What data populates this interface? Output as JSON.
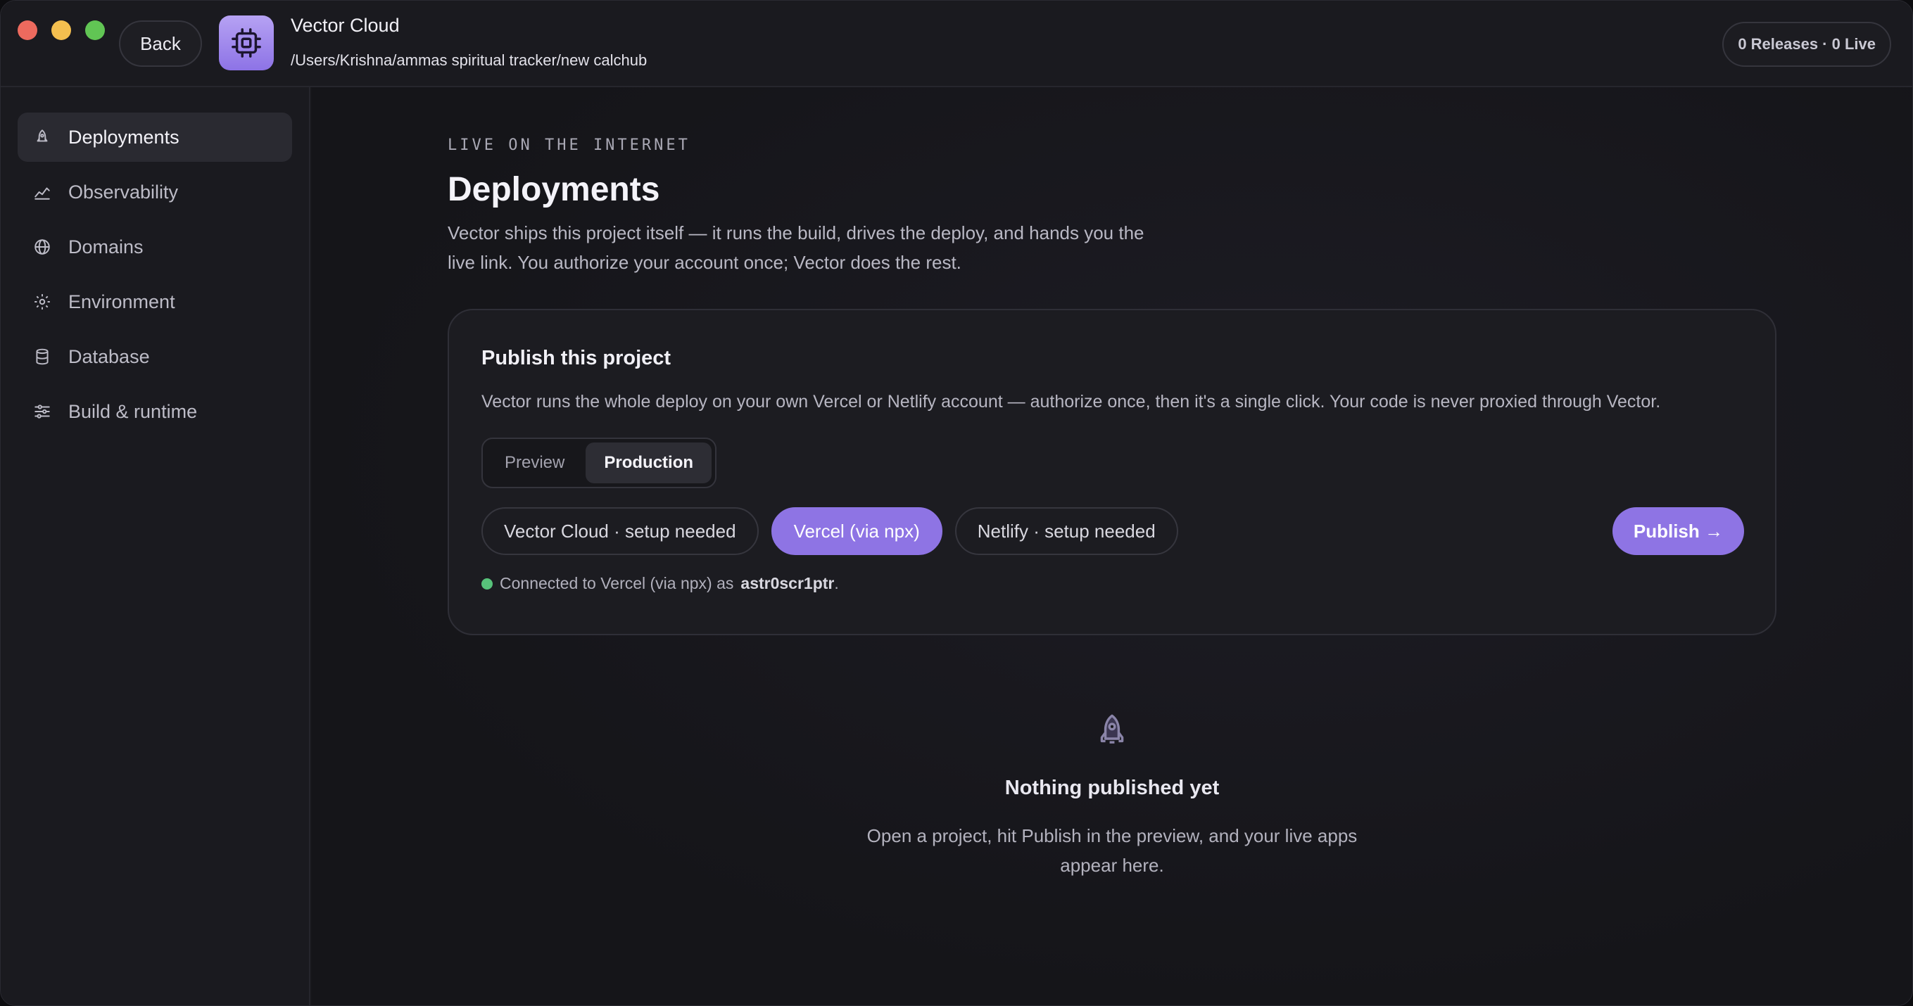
{
  "titlebar": {
    "back_label": "Back",
    "app_title": "Vector Cloud",
    "app_path": "/Users/Krishna/ammas spiritual tracker/new calchub",
    "releases_summary": "0 Releases · 0 Live"
  },
  "sidebar": {
    "items": [
      {
        "label": "Deployments",
        "icon": "rocket-icon",
        "active": true
      },
      {
        "label": "Observability",
        "icon": "chart-icon",
        "active": false
      },
      {
        "label": "Domains",
        "icon": "globe-icon",
        "active": false
      },
      {
        "label": "Environment",
        "icon": "gear-icon",
        "active": false
      },
      {
        "label": "Database",
        "icon": "database-icon",
        "active": false
      },
      {
        "label": "Build & runtime",
        "icon": "sliders-icon",
        "active": false
      }
    ]
  },
  "main": {
    "eyebrow": "LIVE ON THE INTERNET",
    "title": "Deployments",
    "description": "Vector ships this project itself — it runs the build, drives the deploy, and hands you the live link. You authorize your account once; Vector does the rest.",
    "card": {
      "title": "Publish this project",
      "description": "Vector runs the whole deploy on your own Vercel or Netlify account — authorize once, then it's a single click. Your code is never proxied through Vector.",
      "env_tabs": [
        {
          "label": "Preview",
          "active": false
        },
        {
          "label": "Production",
          "active": true
        }
      ],
      "providers": [
        {
          "label": "Vector Cloud · setup needed",
          "active": false
        },
        {
          "label": "Vercel (via npx)",
          "active": true
        },
        {
          "label": "Netlify · setup needed",
          "active": false
        }
      ],
      "publish_label": "Publish →",
      "status_prefix": "Connected to Vercel (via npx) as",
      "status_user": "astr0scr1ptr",
      "status_suffix": "."
    },
    "empty": {
      "title": "Nothing published yet",
      "description": "Open a project, hit Publish in the preview, and your live apps appear here."
    }
  },
  "colors": {
    "accent": "#8e74e4",
    "status_ok": "#57c27a"
  }
}
